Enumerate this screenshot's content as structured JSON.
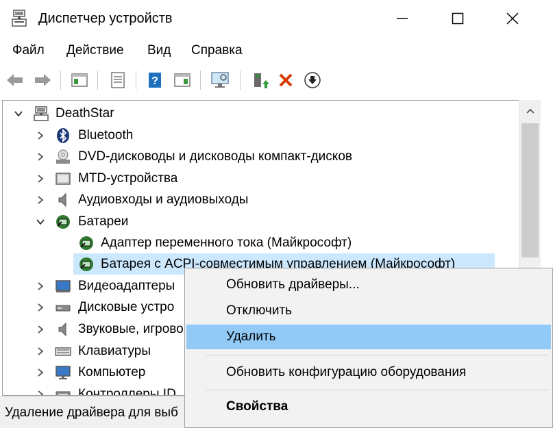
{
  "window": {
    "title": "Диспетчер устройств"
  },
  "menu": [
    "Файл",
    "Действие",
    "Вид",
    "Справка"
  ],
  "toolbar": {
    "buttons": [
      "back-icon",
      "forward-icon",
      "show-hide-console-tree-icon",
      "properties-icon",
      "help-icon",
      "action-pane-icon",
      "scan-hardware-icon",
      "update-driver-icon",
      "uninstall-device-icon",
      "disable-device-icon"
    ]
  },
  "tree": {
    "root": "DeathStar",
    "items": [
      {
        "label": "Bluetooth",
        "icon": "bluetooth-icon"
      },
      {
        "label": "DVD-дисководы и дисководы компакт-дисков",
        "icon": "dvd-drive-icon"
      },
      {
        "label": "MTD-устройства",
        "icon": "mtd-device-icon"
      },
      {
        "label": "Аудиовходы и аудиовыходы",
        "icon": "speaker-icon"
      },
      {
        "label": "Батареи",
        "icon": "battery-icon"
      },
      {
        "label": "Адаптер переменного тока (Майкрософт)",
        "icon": "battery-icon"
      },
      {
        "label": "Батарея с ACPI-совместимым управлением (Майкрософт)",
        "icon": "battery-icon"
      },
      {
        "label": "Видеоадаптеры",
        "icon": "display-adapter-icon"
      },
      {
        "label": "Дисковые устро",
        "icon": "disk-drive-icon"
      },
      {
        "label": "Звуковые, игрово",
        "icon": "sound-icon"
      },
      {
        "label": "Клавиатуры",
        "icon": "keyboard-icon"
      },
      {
        "label": "Компьютер",
        "icon": "computer-icon"
      },
      {
        "label": "Контроллеры ID",
        "icon": "ide-controller-icon"
      }
    ]
  },
  "status": {
    "text": "Удаление драйвера для выб"
  },
  "context_menu": {
    "items": [
      "Обновить драйверы...",
      "Отключить",
      "Удалить",
      "Обновить конфигурацию оборудования",
      "Свойства"
    ]
  },
  "colors": {
    "selection": "#cce8ff",
    "menu_highlight": "#91c9f7",
    "uninstall_red": "#d83b01",
    "help_blue": "#1f6fbf"
  }
}
